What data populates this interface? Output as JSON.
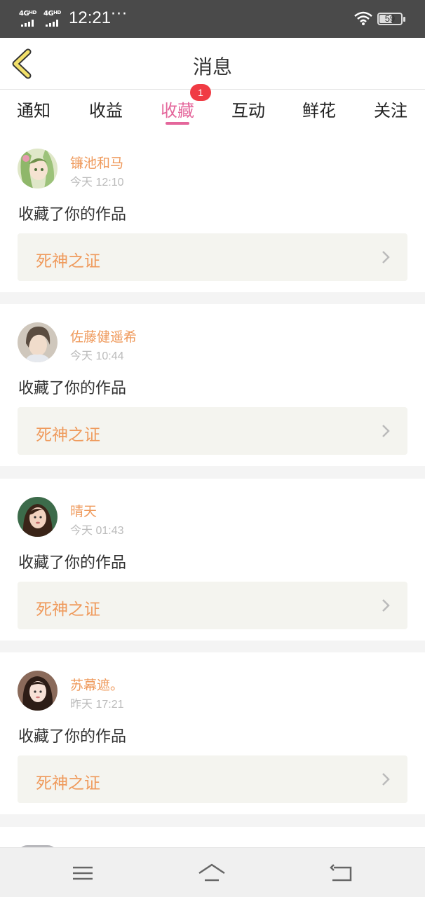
{
  "status_bar": {
    "network1": "4G",
    "network1_hd": "HD",
    "network2": "4G",
    "network2_hd": "HD",
    "time": "12:21",
    "dots": "···",
    "battery": "59",
    "battery_level": 0.59
  },
  "header": {
    "title": "消息",
    "back_icon": "chevron-left-icon"
  },
  "tabs": {
    "items": [
      {
        "label": "通知"
      },
      {
        "label": "收益"
      },
      {
        "label": "收藏",
        "badge": "1"
      },
      {
        "label": "互动"
      },
      {
        "label": "鲜花"
      },
      {
        "label": "关注"
      }
    ],
    "active": "收藏"
  },
  "notifications": [
    {
      "user": "镰池和马",
      "time": "今天 12:10",
      "action": "收藏了你的作品",
      "work_title": "死神之证"
    },
    {
      "user": "佐藤健遥希",
      "time": "今天 10:44",
      "action": "收藏了你的作品",
      "work_title": "死神之证"
    },
    {
      "user": "晴天",
      "time": "今天 01:43",
      "action": "收藏了你的作品",
      "work_title": "死神之证"
    },
    {
      "user": "苏幕遮。",
      "time": "昨天 17:21",
      "action": "收藏了你的作品",
      "work_title": "死神之证"
    }
  ],
  "navbar": {
    "menu_icon": "menu-icon",
    "home_icon": "home-icon",
    "back_icon": "back-arrow-icon"
  },
  "colors": {
    "accent_pink": "#e4669b",
    "username_orange": "#ef9a5c",
    "badge_red": "#f03b44",
    "back_chevron_yellow": "#f2e06a"
  }
}
